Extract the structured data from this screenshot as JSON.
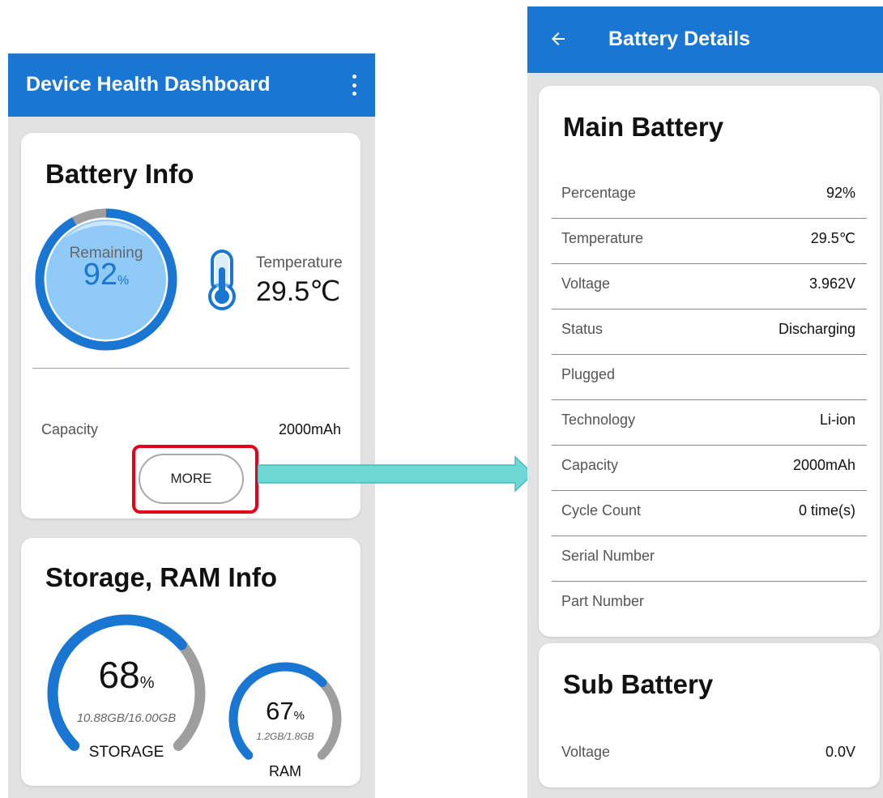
{
  "left_screen": {
    "app_bar": {
      "title": "Device Health Dashboard",
      "menu_icon": "more-vert-icon"
    },
    "battery_card": {
      "heading": "Battery Info",
      "remaining_label": "Remaining",
      "remaining_value": "92",
      "remaining_unit": "%",
      "remaining_level_percent": 92,
      "temperature_icon": "thermometer-icon",
      "temperature_label": "Temperature",
      "temperature_value": "29.5℃",
      "capacity_label": "Capacity",
      "capacity_value": "2000mAh",
      "more_button_label": "MORE"
    },
    "storage_card": {
      "heading": "Storage, RAM Info",
      "storage_value": "68",
      "storage_unit": "%",
      "storage_used": "10.88GB/16.00GB",
      "storage_label": "STORAGE",
      "storage_level_percent": 68,
      "ram_value": "67",
      "ram_unit": "%",
      "ram_used": "1.2GB/1.8GB",
      "ram_label": "RAM",
      "ram_level_percent": 67
    }
  },
  "right_screen": {
    "app_bar": {
      "back_icon": "arrow-back-icon",
      "title": "Battery Details"
    },
    "main_battery": {
      "heading": "Main Battery",
      "rows": [
        {
          "label": "Percentage",
          "value": "92%"
        },
        {
          "label": "Temperature",
          "value": "29.5℃"
        },
        {
          "label": "Voltage",
          "value": "3.962V"
        },
        {
          "label": "Status",
          "value": "Discharging"
        },
        {
          "label": "Plugged",
          "value": ""
        },
        {
          "label": "Technology",
          "value": "Li-ion"
        },
        {
          "label": "Capacity",
          "value": "2000mAh"
        },
        {
          "label": "Cycle Count",
          "value": "0 time(s)"
        },
        {
          "label": "Serial Number",
          "value": ""
        },
        {
          "label": "Part Number",
          "value": ""
        }
      ]
    },
    "sub_battery": {
      "heading": "Sub Battery",
      "rows": [
        {
          "label": "Voltage",
          "value": "0.0V"
        }
      ]
    }
  },
  "colors": {
    "app_bar": "#1976d2",
    "accent_blue": "#1976d2",
    "ring_fill": "#90caf9",
    "gauge_track": "#9e9e9e",
    "highlight": "#e4001b",
    "arrow": "#6fd6d6"
  }
}
